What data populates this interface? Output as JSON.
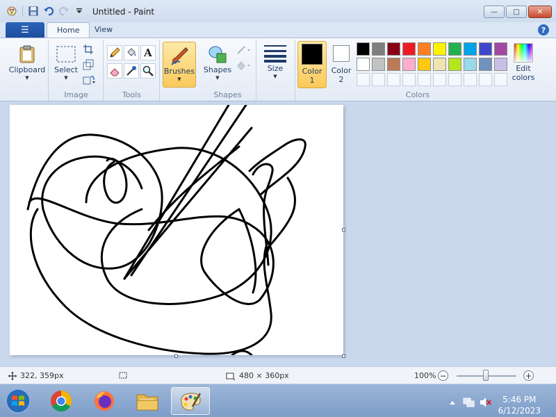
{
  "window": {
    "title": "Untitled - Paint",
    "min_glyph": "—",
    "max_glyph": "□",
    "close_glyph": "✕"
  },
  "tabs": {
    "file_icon": "☰",
    "home": "Home",
    "view": "View",
    "help_glyph": "?"
  },
  "ribbon": {
    "clipboard": {
      "button": "Clipboard",
      "group": ""
    },
    "image": {
      "select": "Select",
      "group": "Image"
    },
    "tools": {
      "group": "Tools",
      "text_glyph": "A"
    },
    "brushes": {
      "button": "Brushes"
    },
    "shapes": {
      "button": "Shapes",
      "group": "Shapes"
    },
    "size": {
      "button": "Size"
    },
    "colors": {
      "color1": "Color",
      "color1_num": "1",
      "color2": "Color",
      "color2_num": "2",
      "edit": "Edit",
      "edit2": "colors",
      "group": "Colors",
      "color1_value": "#000000",
      "color2_value": "#ffffff",
      "palette_row1": [
        "#000000",
        "#7f7f7f",
        "#880015",
        "#ed1c24",
        "#ff7f27",
        "#fff200",
        "#22b14c",
        "#00a2e8",
        "#3f48cc",
        "#a349a4"
      ],
      "palette_row2": [
        "#ffffff",
        "#c3c3c3",
        "#b97a57",
        "#ffaec9",
        "#ffc90e",
        "#efe4b0",
        "#b5e61d",
        "#99d9ea",
        "#7092be",
        "#c8bfe7"
      ]
    }
  },
  "status": {
    "cursor_pos": "322, 359px",
    "canvas_size": "480 × 360px",
    "zoom": "100%",
    "zoom_out": "−",
    "zoom_in": "+"
  },
  "taskbar": {
    "time": "5:46 PM",
    "date": "6/12/2023",
    "apps": [
      "start-orb",
      "chrome",
      "firefox",
      "file-explorer",
      "paint"
    ]
  }
}
